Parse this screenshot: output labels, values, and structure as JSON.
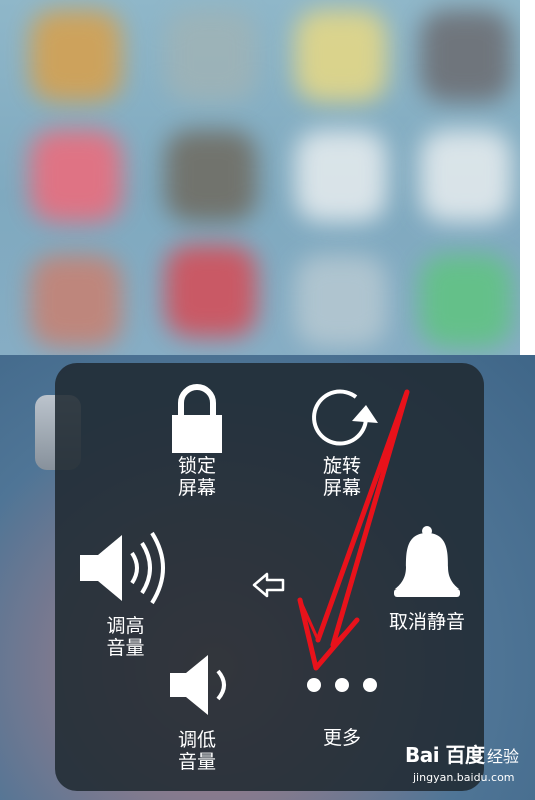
{
  "menu": {
    "lock_screen": {
      "label": "锁定\n屏幕",
      "icon": "lock-icon"
    },
    "rotate_screen": {
      "label": "旋转\n屏幕",
      "icon": "rotate-icon"
    },
    "volume_up": {
      "label": "调高\n音量",
      "icon": "speaker-loud-icon"
    },
    "back": {
      "icon": "back-arrow-icon"
    },
    "unmute": {
      "label": "取消静音",
      "icon": "bell-icon"
    },
    "volume_down": {
      "label": "调低\n音量",
      "icon": "speaker-low-icon"
    },
    "more": {
      "label": "更多",
      "icon": "more-dots-icon"
    }
  },
  "watermark": {
    "brand": "Bai 百度",
    "sub": "jingyan.baidu.com",
    "product": "经验"
  },
  "colors": {
    "panel_bg": "#202a32",
    "icon": "#ffffff",
    "annotation_arrow": "#e8121b"
  }
}
